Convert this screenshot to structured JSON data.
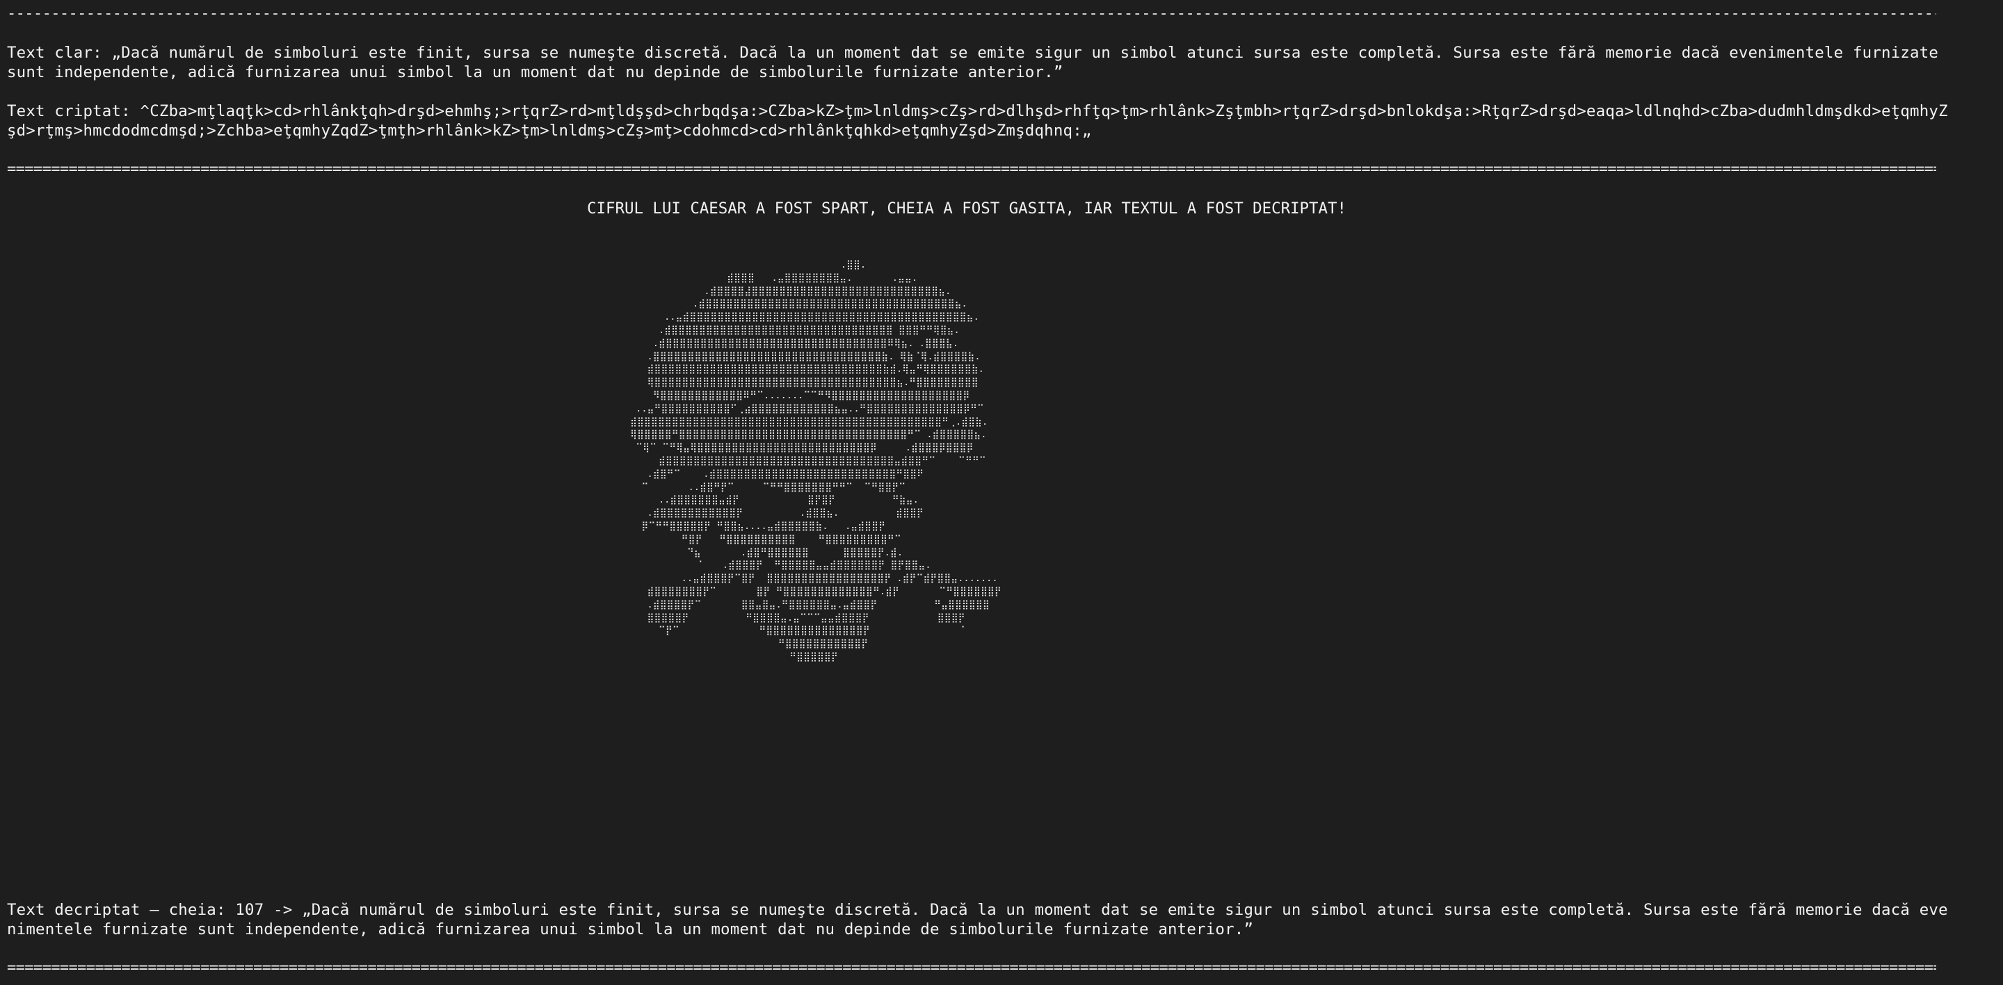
{
  "terminal": {
    "rule_dash": "----------------------------------------------------------------------------------------------------------------------------------------------------------------------------------------------------------------------------------------",
    "rule_equals": "========================================================================================================================================================================================================================================",
    "clear_text": {
      "line1": "Text clar: „Dacă numărul de simboluri este finit, sursa se numeşte discretă. Dacă la un moment dat se emite sigur un simbol atunci sursa este completă. Sursa este fără memorie dacă evenimentele furnizate",
      "line2": "sunt independente, adică furnizarea unui simbol la un moment dat nu depinde de simbolurile furnizate anterior.”"
    },
    "cipher_text": {
      "line1": "Text criptat: ^CZba>mţlaqţk>cd>rhlânkţqh>drşd>ehmhş;>rţqrZ>rd>mţldşşd>chrbqdşa:>CZba>kZ>ţm>lnldmş>cZş>rd>dlhşd>rhfţq>ţm>rhlânk>Zşţmbh>rţqrZ>drşd>bnlokdşa:>RţqrZ>drşd>eaqa>ldlnqhd>cZba>dudmhldmşdkd>eţqmhyZ",
      "line2": "şd>rţmş>hmcdodmcdmşd;>Zchba>eţqmhyZqdZ>ţmţh>rhlânk>kZ>ţm>lnldmş>cZş>mţ>cdohmcd>cd>rhlânkţqhkd>eţqmhyZşd>Zmşdqhnq:„"
    },
    "headline": "CIFRUL LUI CAESAR A FOST SPART, CHEIA A FOST GASITA, IAR TEXTUL A FOST DECRIPTAT!",
    "ascii_art": "                                     .⣿⣿.\n                 ⣾⣿⣿⣿   .⣤⣿⣿⣿⣿⣿⣿⣿⣿⣤.       .⣤⣤.\n             .⣾⣿⣿⣿⣿⣼⣿⣿⣿⣿⣿⣿⣿⣿⣿⣿⣿⣿⣿⣿⣿⣿⣿⣿⣿⣿⣿⣿⣿⣿⣿⣿⣿⣦.\n           .⣾⣿⣿⣿⣿⣿⣿⣿⣿⣿⣿⣿⣿⣿⣿⣿⣿⣿⣿⣿⣿⣿⣿⣿⣿⣿⣿⣿⣿⣿⣿⣿⣿⣿⣿⣿⣿⣦.\n      ..⣤⣾⣿⣿⣿⣿⣿⣿⣿⣿⣿⣿⣿⣿⣿⣿⣿⣿⣿⣿⣿⣿⣿⣿⣿⣿⣿⣿⣿⣿⣿⣿⣿⣿⣿⣿⣿⣿⣿⣿⣿⣿⣦.\n     .⣾⣿⣿⣿⣿⣿⣿⣿⣿⣿⣿⣿⣿⣿⣿⣿⣿⣿⣿⣿⣿⣿⣿⣿⣿⣿⣿⣿⣿⣿⣿⣿⣿ ⣿⣿⣿⠛⠛⢿⣿⣦.\n    .⣾⣿⣿⣿⣿⣿⣿⣿⣿⣿⣿⣿⣿⣿⣿⣿⣿⣿⣿⣿⣿⣿⣿⣿⣿⣿⣿⣿⣿⣿⣿⣿⣿⠿⢿⣦. .⣿⣿⣿⣧.\n   .⣿⣿⣿⣿⣿⣿⣿⣿⣿⣿⣿⣿⣿⣿⣿⣿⣿⣿⣿⣿⣿⣿⣿⣿⣿⣿⣿⣿⣿⣿⣿⣿⣿⣷. ⢿⣷⠈⢿.⣾⣿⣿⣿⣿⣷.\n   ⣾⣿⣿⣿⣿⣿⣿⣿⣿⣿⣿⣿⣿⣿⣿⣿⣿⣿⣿⣿⣿⣿⣿⣿⣿⣿⣿⣿⣿⣿⣿⣿⣿⣿⣷⣾.⢿⣤⠛⢿⣿⣿⣿⣿⣿⣿⣷.\n   ⢿⣿⣿⣿⣿⣿⣿⣿⣿⣿⣿⣿⣿⣿⣿⣿⣿⣿⣿⣿⣿⣿⣿⣿⣿⣿⣿⣿⣿⣿⣿⣿⣿⣿⣿⣿⣦.⠛⣿⣿⣿⣿⣿⣿⣿⣿⣿\n    ⠻⣿⣿⣿⣿⣿⣿⣿⣿⣿⣿⣿⣿⠿⠛⠉.......⠉⠉⠛⠻⣿⣿⣿⣿⣿⣿⣿⣿⣿⣿⣿⣿⣿⣿⣿⣿⣿⣿⣿⡿\n ..⣤⠛⣿⣿⣿⣿⣿⣿⣿⣿⣿⣿⠋⢀⣴⣿⣿⣿⣿⣿⣿⣿⣿⣿⣿⣿⣿⣦⣤..⠛⣿⣿⣿⣿⣿⣿⣿⣿⣿⣿⣿⣿⣿⣿⡿⠛⠉\n⣾⣿⣿⣿⣿⣿⣿⣿⣿⣿⣿⣿⣿⣿⣿⣿⣿⣿⣿⣿⣿⣿⣿⣿⣿⣿⣿⣿⣿⣿⣿⣿⣿⣿⣿⣿⣿⣿⣿⣿⣿⣿⣿⣿⣿⠛⢀.⣾⣿⣷.\n⢿⣿⣿⣿⣿⣿⠛⣿⣿⣿⣿⣿⣿⣿⣿⣿⣿⣿⣿⣿⣿⣿⣿⣿⣿⣿⣿⣿⣿⣿⣿⣿⣿⣿⣿⣿⣿⣿⣿⣿⠛⠉ .⣾⣿⣿⣿⣿⣿⣦.\n ⠉⢿⠉ ⠉⠛⢿⣤⢿⣿⣿⣿⣿⣿⣿⣿⣿⣿⣿⣿⣿⣿⣿⣿⣿⣿⣿⣿⣿⣿⣿⣿⣿⣿⡿     .⣾⣿⣿⣿⡿⣿⣿⣿⡿\n     ⣾⣿⣿⣿⣿⣿⣿⣿⣿⣿⣿⣿⣿⣿⣿⣿⣿⣿⣿⣿⣿⣿⣿⣿⣿⣿⣿⣿⣿⣿⣿⣿⣿⣿⣤⣾⣿⣿⠛⠉    ⠉⠛⠛⠉\n   .⣾⣿⠛⠉    .⣾⣿⣿⣿⣿⣿⣿⣿⣿⣿⣿⣿⣿⣿⣿⣿⣿⣿⣿⣿⣿⣿⣿⣿⣿⣿⣿⠛⣿⣿⠟\n  ⠉       ..⣾⣿⠛⡟⠉     ⠉⠛⠛⣿⣿⣿⣿⣿⣿⣿⠛⠛⠉  ⠉⠛⣿⣿⡟⠉\n     ..⣾⣿⣿⣿⣿⣿⣿⣤⣾⡟            ⣿⡟⣿⡟          ⠛⣷⣤.\n   .⣾⣿⣿⣿⣿⣿⣿⣿⣿⣿⣿⣿⡟          .⣾⣿⣿⣦.          ⣾⣿⣿⡟\n  ⡿⠉⠛⠛⣿⣿⣿⣿⣿⡟ ⠛⣿⣿⣦....⣤⣾⣿⣿⣿⣿⣿⣷.   .⣤⣾⣿⣿⡟\n         ⠛⣿⡟   ⠛⣿⣿⣿⣿⣿⣿⣿⣿⣿⣿    ⠛⣿⣿⣿⣿⣿⣿⣿⣿⣿⠛⠉\n          ⠙⣦       .⣾⣿⠛⣿⣿⣿⣿⣿⣿      ⣿⣿⣿⣿⣿⡟.⣾.\n            ⠁   .⣾⣿⣿⣿⡟  ⠛⣿⣿⣿⣿⣿⣤⣤⣾⣿⣿⣿⣿⣿⣿⡟ ⣿⡟⣿⣿⣤.\n         ..⣤⣾⣿⣿⣿⡟⠉⣿⡟  ⣿⣿⣿⣿⣿⣿⣿⣿⣿⣿⣿⣿⣿⣿⣿⣿⣿⡟ .⣾⡟⠉⣾⡟⣿⣿⣤.......\n   ⣾⣿⣿⣿⣿⣿⣿⣿⡟⠉       ⣿⡟ ⠛⣿⣿⣿⣿⣿⣿⣿⣿⣿⣿⣿⣿⣿⠛.⣾⡟       ⠉⠛⣿⣿⣿⣿⣿⣿⡟\n   .⣾⣿⣿⣿⣿⡟⠉       ⣿⣿⣤⣿⣤.⠛⣿⣿⣿⣿⣿⣿⣤.⣤⣾⣿⣿⡟          ⠛⣤⣿⣿⣿⣿⣿⣿\n   ⣿⣿⣿⣿⣿⡟          ⠛⣿⣿⣿⣿⣤.⣤⠉⠉⠉⣤⣤⣾⣿⣿⣿⡟            ⣿⣿⣿⡟\n     ⠉⡟⠉              ⠛⣿⣿⣿⣿⣿⣿⣿⣿⣿⣿⣿⣿⣿⣿⡟                ⠁\n                          ⠛⣿⣿⣿⣿⣿⣿⣿⣿⣿⣿⣿⡟\n                            ⠛⣿⣿⣿⣿⣿⡟",
    "decrypted": {
      "line1": "Text decriptat – cheia: 107 -> „Dacă numărul de simboluri este finit, sursa se numeşte discretă. Dacă la un moment dat se emite sigur un simbol atunci sursa este completă. Sursa este fără memorie dacă eve",
      "line2": "nimentele furnizate sunt independente, adică furnizarea unui simbol la un moment dat nu depinde de simbolurile furnizate anterior.”"
    }
  }
}
